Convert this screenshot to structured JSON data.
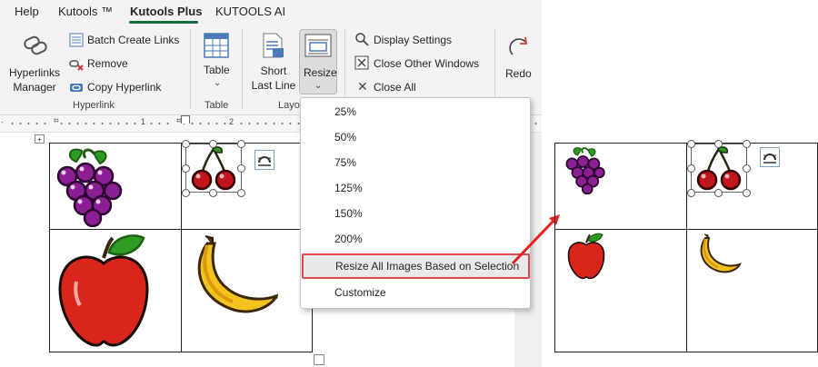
{
  "tabs": [
    {
      "label": "Help"
    },
    {
      "label": "Kutools ™"
    },
    {
      "label": "Kutools Plus"
    },
    {
      "label": "KUTOOLS AI"
    }
  ],
  "ribbon": {
    "hyperlinks_manager": "Hyperlinks Manager",
    "hyperlinks_manager_line1": "Hyperlinks",
    "hyperlinks_manager_line2": "Manager",
    "batch_create_links": "Batch Create Links",
    "remove": "Remove",
    "copy_hyperlink": "Copy Hyperlink",
    "group_hyperlink": "Hyperlink",
    "table": "Table",
    "group_table": "Table",
    "short_last_line_1": "Short",
    "short_last_line_2": "Last Line",
    "resize": "Resize",
    "group_layout": "Layo",
    "display_settings": "Display Settings",
    "close_other_windows": "Close Other Windows",
    "close_all": "Close All",
    "redo": "Redo"
  },
  "ruler": {
    "mark_1": "1",
    "mark_2": "2"
  },
  "resize_menu": {
    "items": [
      "25%",
      "50%",
      "75%",
      "125%",
      "150%",
      "200%",
      "Resize All Images Based on Selection",
      "Customize"
    ],
    "highlighted_index": 6
  },
  "colors": {
    "accent": "#1a6b3c",
    "highlight_border": "#e0484e",
    "arrow": "#e8201e"
  }
}
